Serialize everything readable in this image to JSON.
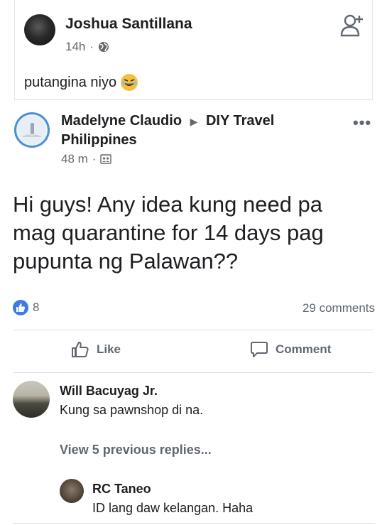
{
  "post1": {
    "author": "Joshua Santillana",
    "time": "14h",
    "privacy_icon": "globe-icon",
    "text": "putangina niyo",
    "emoji": "laughing-emoji-icon"
  },
  "post2": {
    "author": "Madelyne Claudio",
    "separator_icon": "triangle-right-icon",
    "group": "DIY Travel Philippines",
    "time": "48 m",
    "privacy_icon": "group-icon",
    "more_label": "•••",
    "body": "Hi guys! Any idea kung need pa mag quarantine for 14 days pag pupunta ng Palawan??",
    "like_count": "8",
    "comment_count": "29 comments",
    "actions": {
      "like": "Like",
      "comment": "Comment"
    }
  },
  "comments": [
    {
      "author": "Will Bacuyag Jr.",
      "text": "Kung sa pawnshop di na."
    }
  ],
  "view_previous": "View 5 previous replies...",
  "replies": [
    {
      "author": "RC Taneo",
      "text": "ID lang daw kelangan. Haha"
    }
  ],
  "colors": {
    "like_blue": "#3b7be6",
    "text_primary": "#1c1e21",
    "text_secondary": "#606770",
    "divider": "#dadde1"
  }
}
